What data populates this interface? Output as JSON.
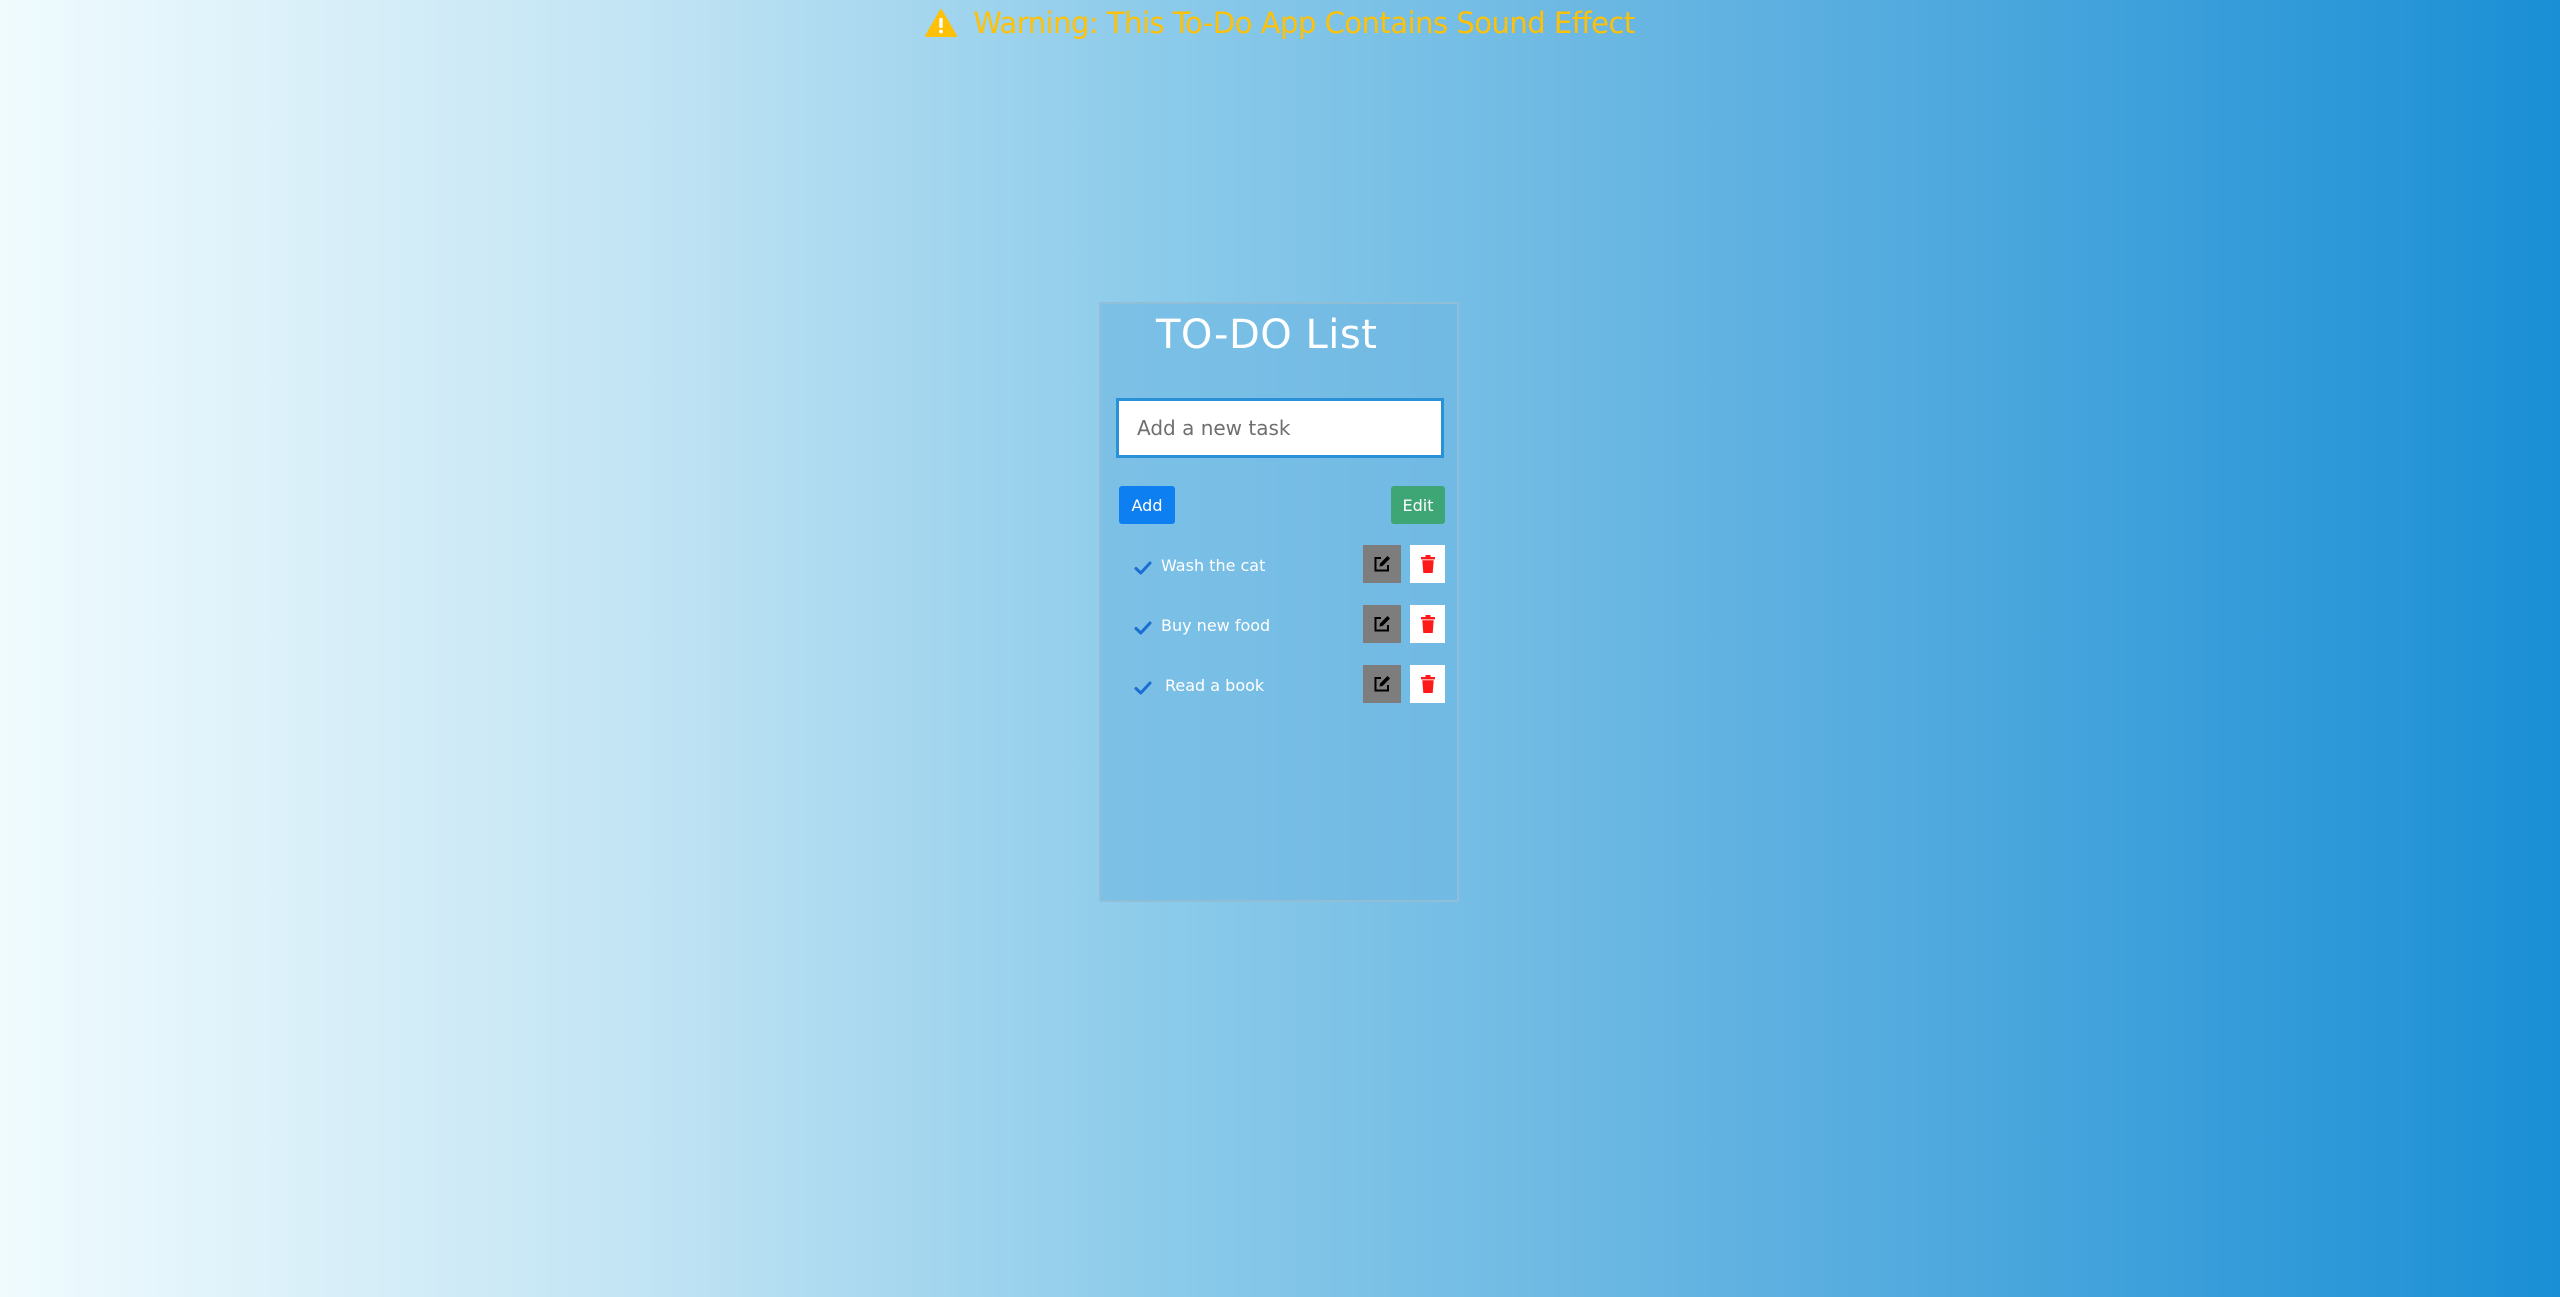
{
  "warning": {
    "text": "Warning: This To-Do App Contains Sound Effect",
    "icon": "warning-triangle-icon",
    "color": "#ffc107"
  },
  "todo": {
    "title": "TO-DO List",
    "input": {
      "placeholder": "Add a new task",
      "value": ""
    },
    "add_label": "Add",
    "edit_label": "Edit",
    "tasks": [
      {
        "text": "Wash the cat",
        "icon": "check-icon",
        "edit_icon": "edit-icon",
        "delete_icon": "trash-icon"
      },
      {
        "text": "Buy new food",
        "icon": "check-icon",
        "edit_icon": "edit-icon",
        "delete_icon": "trash-icon"
      },
      {
        "text": "Read a book",
        "icon": "check-icon",
        "edit_icon": "edit-icon",
        "delete_icon": "trash-icon"
      }
    ]
  },
  "colors": {
    "add_button": "#0d7ff0",
    "edit_button": "#3ea575",
    "task_edit_button": "#7d7d7d",
    "delete_icon": "#ff1a1a",
    "check_icon": "#1b6fd0"
  }
}
